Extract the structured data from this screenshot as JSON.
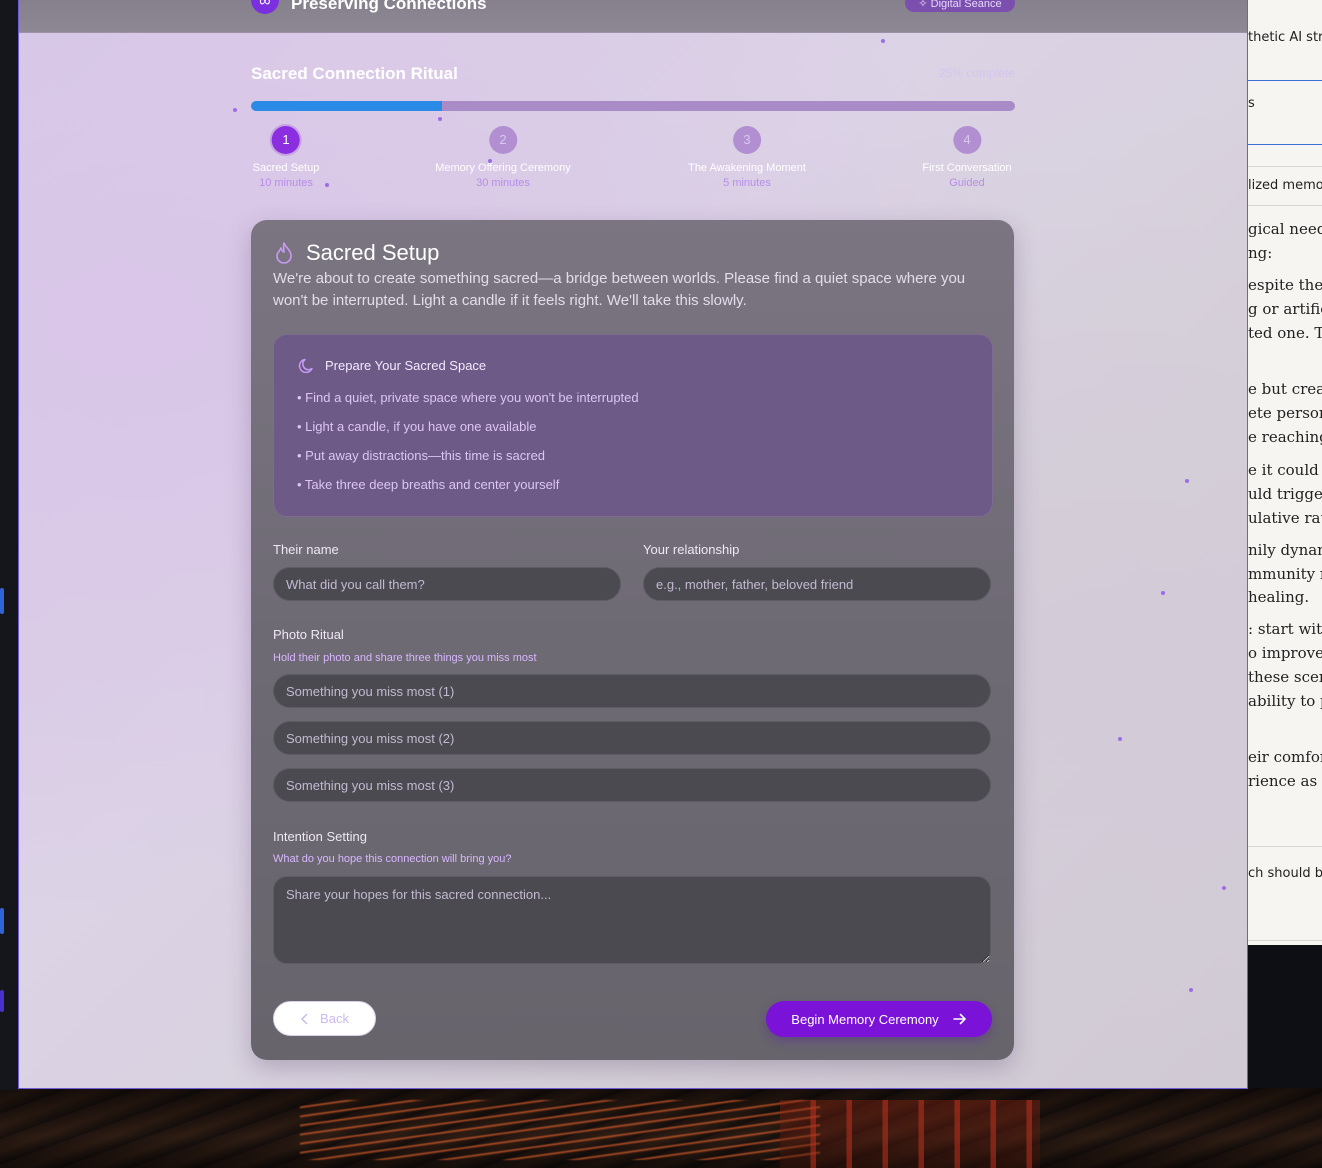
{
  "app": {
    "title": "Preserving Connections",
    "logo_glyph": "∞",
    "badge": "✧ Digital Seance"
  },
  "ritual": {
    "title": "Sacred Connection Ritual",
    "progress_text": "25% complete",
    "progress_fraction": 0.25,
    "steps": [
      {
        "number": "1",
        "label": "Sacred Setup",
        "duration": "10 minutes"
      },
      {
        "number": "2",
        "label": "Memory Offering Ceremony",
        "duration": "30 minutes"
      },
      {
        "number": "3",
        "label": "The Awakening Moment",
        "duration": "5 minutes"
      },
      {
        "number": "4",
        "label": "First Conversation",
        "duration": "Guided"
      }
    ]
  },
  "card": {
    "title": "Sacred Setup",
    "intro": "We're about to create something sacred—a bridge between worlds. Please find a quiet space where you won't be interrupted. Light a candle if it feels right. We'll take this slowly.",
    "prepare": {
      "title": "Prepare Your Sacred Space",
      "items": [
        "• Find a quiet, private space where you won't be interrupted",
        "• Light a candle, if you have one available",
        "• Put away distractions—this time is sacred",
        "• Take three deep breaths and center yourself"
      ]
    },
    "fields": {
      "name_label": "Their name",
      "name_placeholder": "What did you call them?",
      "relationship_label": "Your relationship",
      "relationship_placeholder": "e.g., mother, father, beloved friend",
      "photo_label": "Photo Ritual",
      "photo_hint": "Hold their photo and share three things you miss most",
      "miss_1": "Something you miss most (1)",
      "miss_2": "Something you miss most (2)",
      "miss_3": "Something you miss most (3)",
      "intention_label": "Intention Setting",
      "intention_hint": "What do you hope this connection will bring you?",
      "intention_placeholder": "Share your hopes for this sacred connection..."
    },
    "back_label": "Back",
    "next_label": "Begin Memory Ceremony"
  },
  "background_doc": {
    "lines": [
      "thetic AI str",
      "s",
      "lized memo",
      "gical needs",
      "ng:",
      "espite the co",
      "g or artifici",
      "ted one. Th",
      "e but create",
      "ete person",
      "e reaching",
      "e it could c",
      "uld trigger",
      "ulative rath",
      "nily dynam",
      "mmunity n",
      "healing.",
      ": start with",
      "o improve c",
      " these scen",
      " ability to p",
      "eir comfort",
      "rience as th",
      "ch should b"
    ]
  },
  "colors": {
    "accent": "#7a12d8",
    "progress_fill": "#2a8be6",
    "progress_track": "#a98bc8",
    "window_border": "#6f5ad8"
  }
}
